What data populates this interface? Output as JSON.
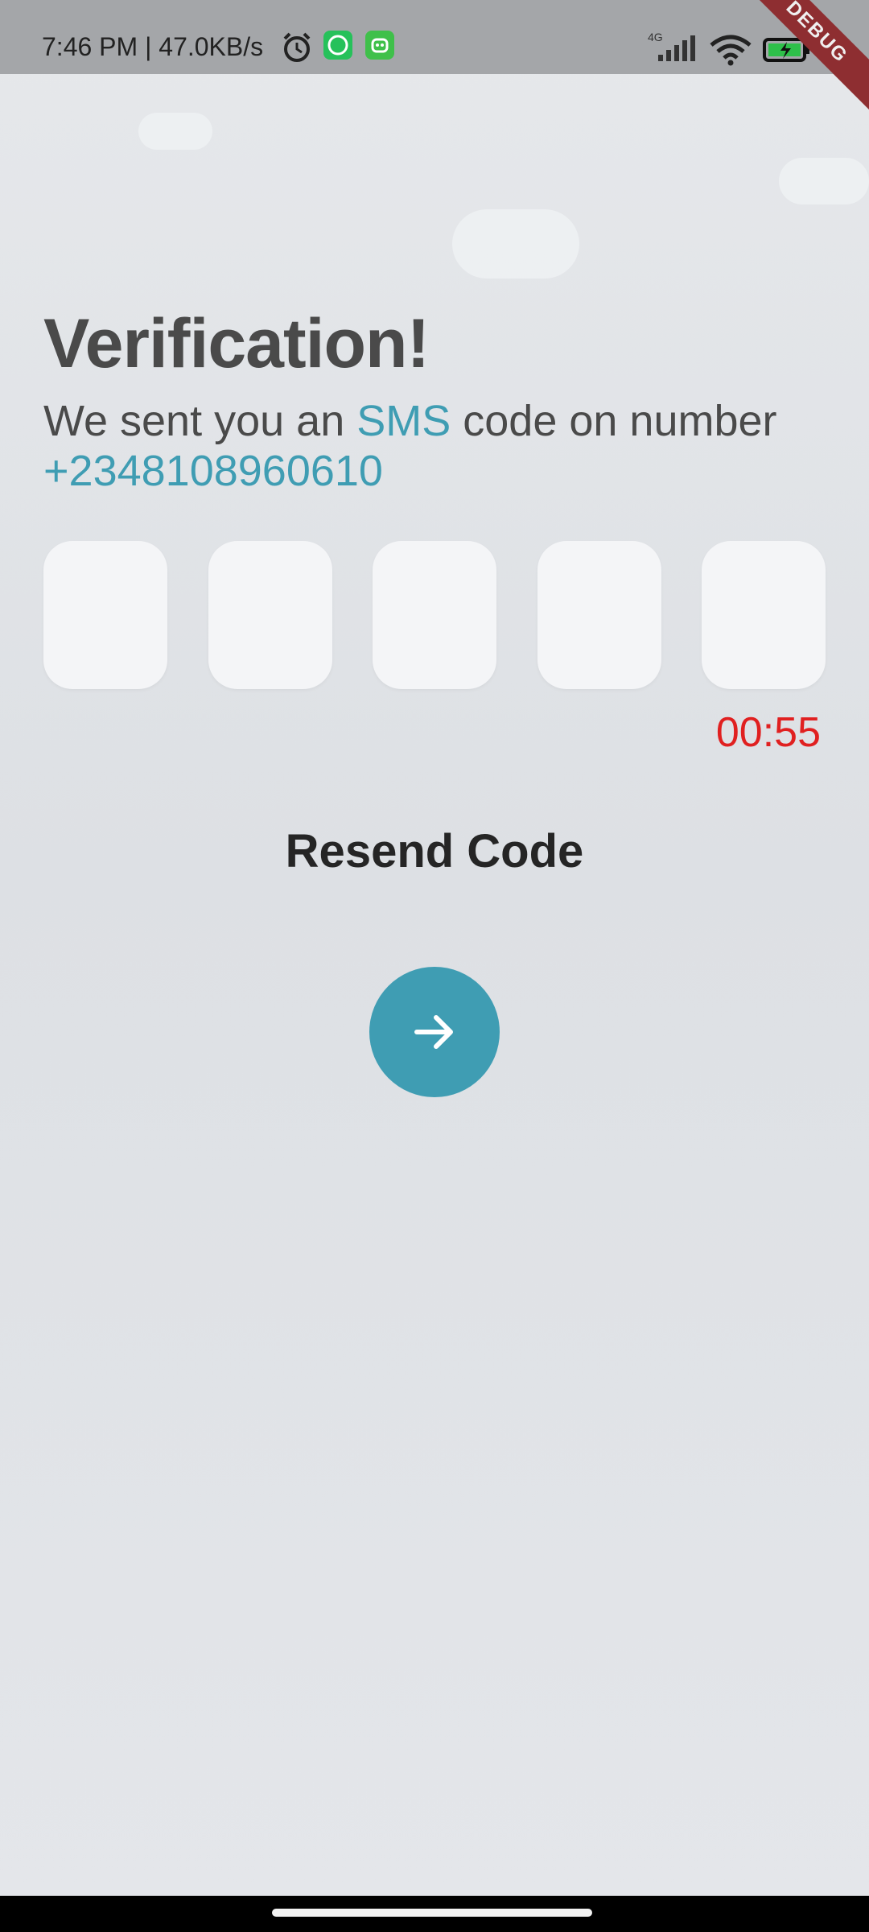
{
  "status_bar": {
    "time_speed": "7:46 PM | 47.0KB/s",
    "network_label": "4G",
    "icons": [
      "alarm-icon",
      "whatsapp-icon",
      "app-robot-icon",
      "signal-icon",
      "wifi-icon",
      "battery-charging-icon"
    ]
  },
  "debug_banner": "DEBUG",
  "verification": {
    "title": "Verification!",
    "subtitle_before": "We sent you an ",
    "subtitle_sms": "SMS",
    "subtitle_after": " code on number",
    "phone": "+2348108960610",
    "code_boxes": [
      "",
      "",
      "",
      "",
      ""
    ],
    "timer": "00:55",
    "resend_label": "Resend Code",
    "next_icon": "arrow-right-icon"
  },
  "colors": {
    "accent": "#3f9db3",
    "timer": "#e02020",
    "title": "#4a4a4a",
    "background": "#e3e5e9"
  }
}
